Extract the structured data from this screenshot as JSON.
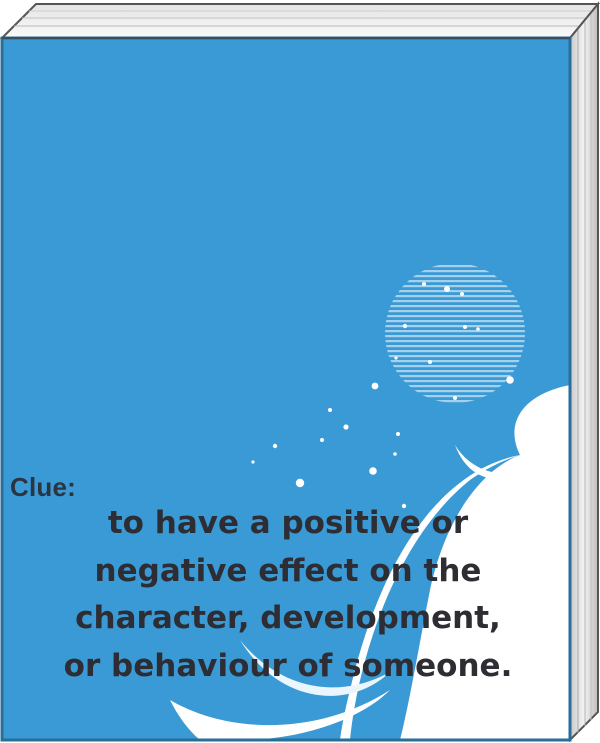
{
  "cover": {
    "colors": {
      "cover_blue": "#3a9ad6",
      "cover_border": "#2a6e98",
      "page_white": "#ffffff",
      "accent_cyan": "#35c0ec",
      "text_dark": "#2d2d33"
    }
  },
  "clue": {
    "label": "Clue:",
    "lines": [
      "to have a positive or",
      "negative effect on the",
      "character, development,",
      "or behaviour of someone."
    ]
  }
}
